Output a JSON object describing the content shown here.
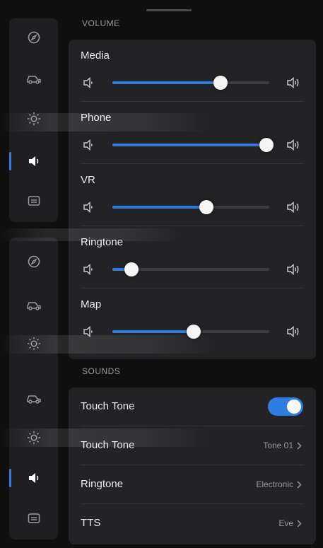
{
  "sections": {
    "volume_title": "VOLUME",
    "sounds_title": "SOUNDS"
  },
  "rail_top": [
    {
      "icon": "compass-icon",
      "active": false
    },
    {
      "icon": "car-icon",
      "active": false
    },
    {
      "icon": "brightness-icon",
      "active": false
    },
    {
      "icon": "speaker-icon",
      "active": true
    },
    {
      "icon": "screen-icon",
      "active": false
    }
  ],
  "rail_bottom": [
    {
      "icon": "compass-icon",
      "active": false
    },
    {
      "icon": "car-icon",
      "active": false
    },
    {
      "icon": "brightness-icon",
      "active": false
    },
    {
      "icon": "car-icon",
      "active": false
    },
    {
      "icon": "brightness-icon",
      "active": false
    },
    {
      "icon": "speaker-icon",
      "active": true
    },
    {
      "icon": "screen-icon",
      "active": false
    }
  ],
  "volume": {
    "rows": [
      {
        "label": "Media",
        "level": 0.69
      },
      {
        "label": "Phone",
        "level": 0.98
      },
      {
        "label": "VR",
        "level": 0.6
      },
      {
        "label": "Ringtone",
        "level": 0.12
      },
      {
        "label": "Map",
        "level": 0.52
      }
    ]
  },
  "sounds": {
    "touch_tone_toggle": {
      "label": "Touch Tone",
      "on": true
    },
    "touch_tone": {
      "label": "Touch Tone",
      "value": "Tone 01"
    },
    "ringtone": {
      "label": "Ringtone",
      "value": "Electronic"
    },
    "tts": {
      "label": "TTS",
      "value": "Eve"
    }
  },
  "colors": {
    "accent": "#2f7de1",
    "background": "#0f0f10",
    "card": "#232325"
  }
}
